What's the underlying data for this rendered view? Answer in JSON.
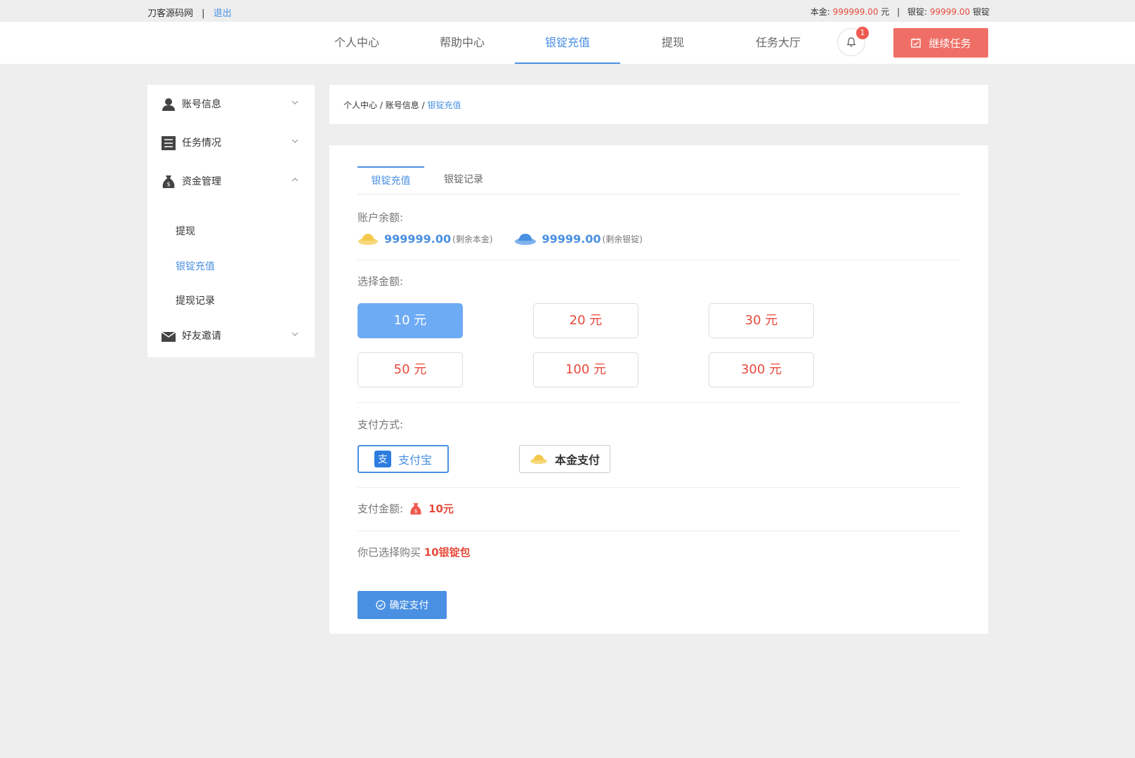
{
  "topbar": {
    "site_name": "刀客源码网",
    "separator": "|",
    "logout": "退出",
    "principal_label": "本金:",
    "principal_value": "999999.00",
    "principal_unit": "元",
    "right_separator": "|",
    "ingot_label": "银锭:",
    "ingot_value": "99999.00",
    "ingot_unit": "银锭"
  },
  "nav": {
    "items": [
      {
        "label": "个人中心"
      },
      {
        "label": "帮助中心"
      },
      {
        "label": "银锭充值",
        "active": true
      },
      {
        "label": "提现"
      },
      {
        "label": "任务大厅"
      }
    ],
    "notification_count": "1",
    "continue_task": "继续任务"
  },
  "sidebar": {
    "items": [
      {
        "label": "账号信息",
        "icon": "user-icon",
        "expanded": false
      },
      {
        "label": "任务情况",
        "icon": "list-icon",
        "expanded": false
      },
      {
        "label": "资金管理",
        "icon": "money-bag-icon",
        "expanded": true
      },
      {
        "label": "好友邀请",
        "icon": "envelope-icon",
        "expanded": false
      }
    ],
    "sub_items": [
      {
        "label": "提现"
      },
      {
        "label": "银锭充值",
        "active": true
      },
      {
        "label": "提现记录"
      }
    ]
  },
  "breadcrumb": {
    "items": [
      "个人中心",
      "账号信息",
      "银锭充值"
    ],
    "separator": "/"
  },
  "tabs": [
    {
      "label": "银锭充值",
      "active": true
    },
    {
      "label": "银锭记录"
    }
  ],
  "balance": {
    "label": "账户余额:",
    "principal_value": "999999.00",
    "principal_note": "(剩余本金)",
    "ingot_value": "99999.00",
    "ingot_note": "(剩余银锭)"
  },
  "amounts": {
    "label": "选择金额:",
    "options": [
      "10 元",
      "20 元",
      "30 元",
      "50 元",
      "100 元",
      "300 元"
    ],
    "selected_index": 0
  },
  "payment": {
    "label": "支付方式:",
    "methods": [
      {
        "label": "支付宝",
        "icon": "alipay-icon",
        "selected": true
      },
      {
        "label": "本金支付",
        "icon": "gold-ingot-icon",
        "selected": false
      }
    ]
  },
  "pay_amount": {
    "label": "支付金额:",
    "value": "10元"
  },
  "purchase": {
    "prefix": "你已选择购买",
    "value": "10银锭包"
  },
  "confirm": {
    "label": "确定支付"
  },
  "colors": {
    "accent": "#4a90e2",
    "danger": "#e64a3b",
    "continue": "#ef6f66",
    "selected_amount": "#6eabf5"
  }
}
